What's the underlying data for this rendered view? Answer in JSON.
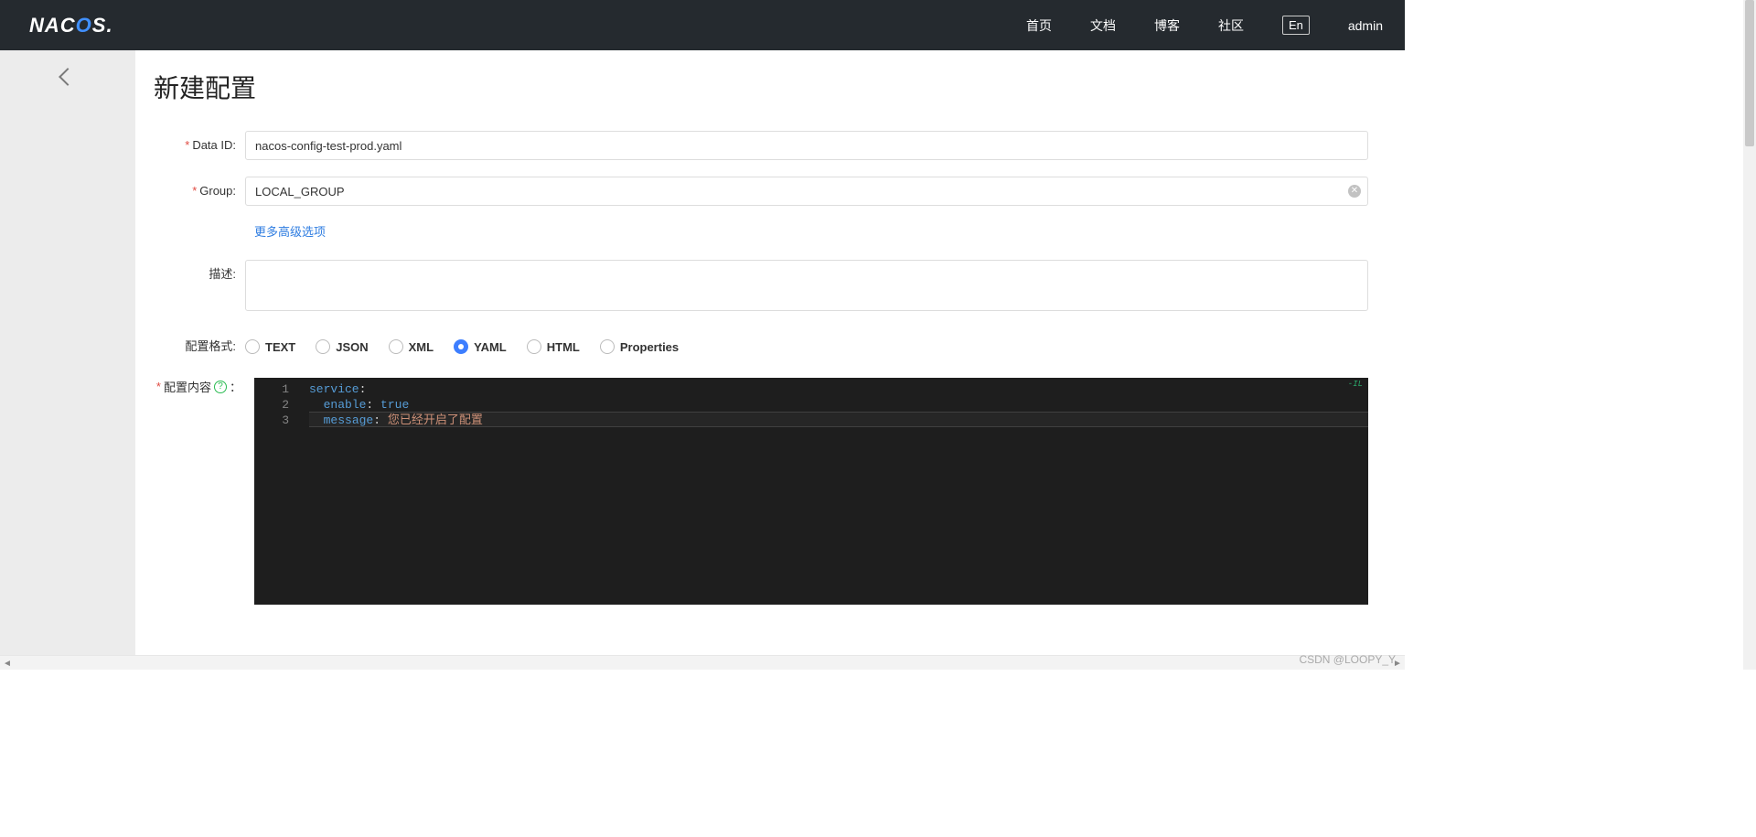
{
  "header": {
    "logo_prefix": "NAC",
    "logo_accent": "O",
    "logo_suffix": "S.",
    "nav": [
      "首页",
      "文档",
      "博客",
      "社区"
    ],
    "lang_btn": "En",
    "user": "admin"
  },
  "page": {
    "title": "新建配置",
    "more_link": "更多高级选项",
    "watermark": "CSDN @LOOPY_Y"
  },
  "labels": {
    "data_id": "Data ID:",
    "group": "Group:",
    "desc": "描述:",
    "format": "配置格式:",
    "content": "配置内容",
    "content_colon": "："
  },
  "form": {
    "data_id": "nacos-config-test-prod.yaml",
    "group": "LOCAL_GROUP",
    "desc": "",
    "selected_format": "YAML",
    "formats": [
      "TEXT",
      "JSON",
      "XML",
      "YAML",
      "HTML",
      "Properties"
    ]
  },
  "editor": {
    "lines": [
      {
        "indent": 0,
        "key": "service",
        "value_type": "none"
      },
      {
        "indent": 1,
        "key": "enable",
        "value_type": "bool",
        "value": "true"
      },
      {
        "indent": 1,
        "key": "message",
        "value_type": "string",
        "value": "您已经开启了配置"
      }
    ],
    "cursor_line": 3,
    "badge": "-IL"
  }
}
